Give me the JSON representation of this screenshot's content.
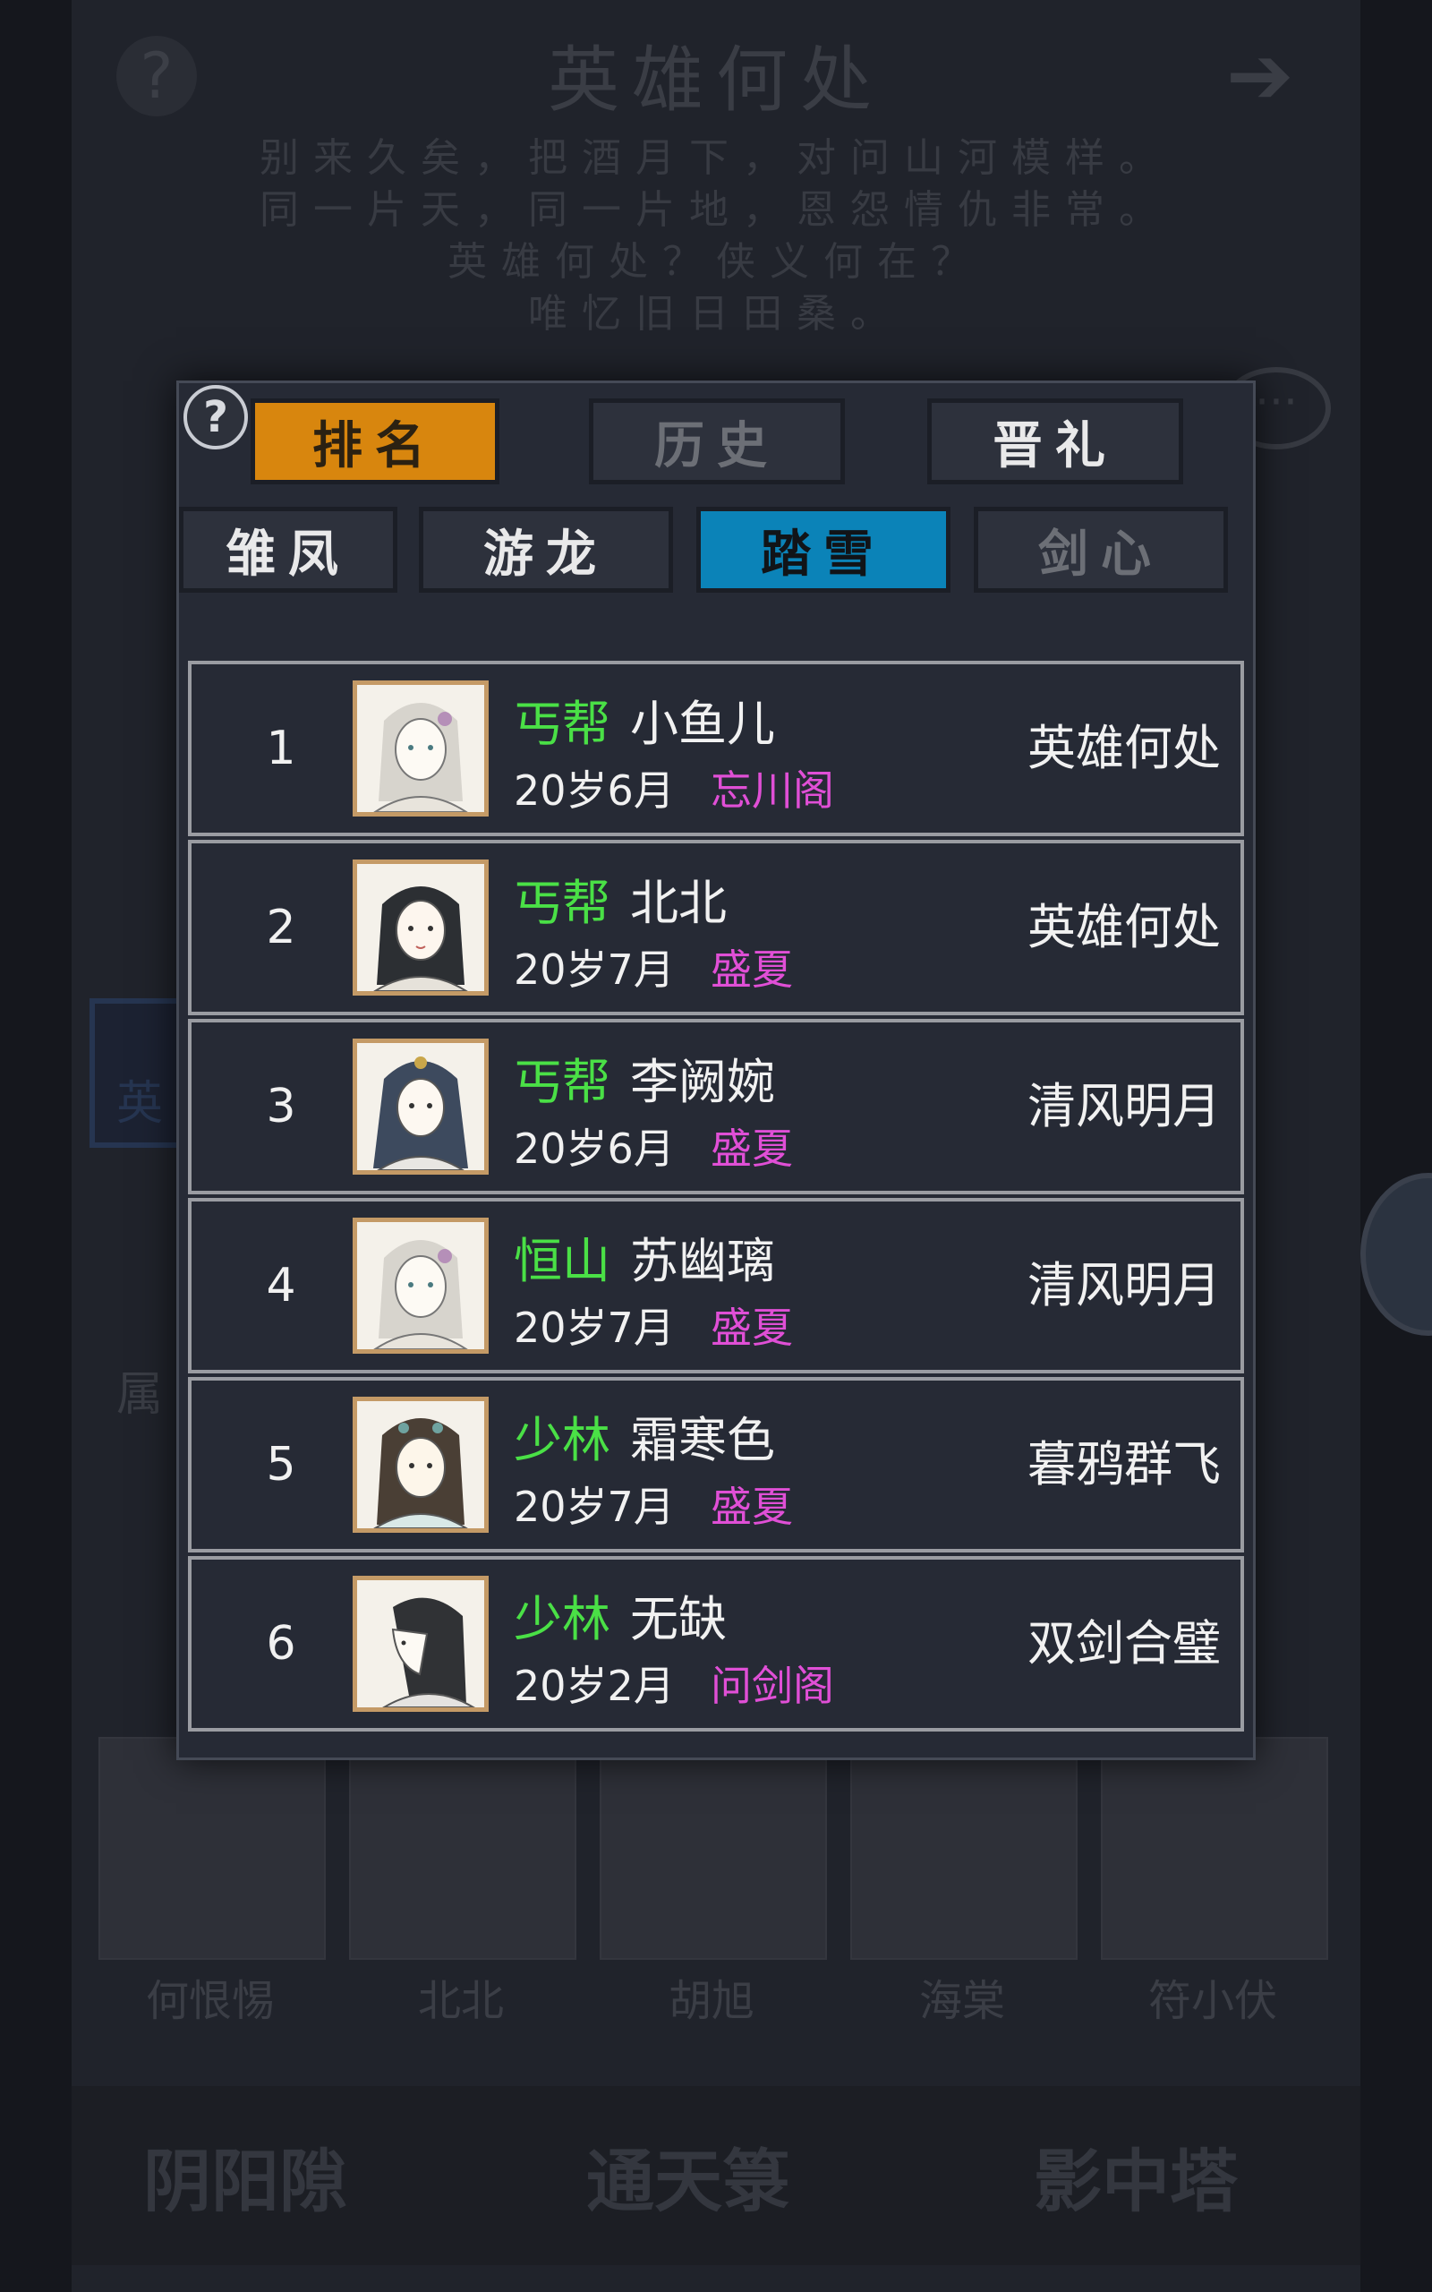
{
  "background": {
    "title": "英雄何处",
    "poem": [
      "别来久矣，把酒月下，对问山河模样。",
      "同一片天，同一片地，恩怨情仇非常。",
      "英雄何处？侠义何在？",
      "唯忆旧日田桑。"
    ],
    "side_label": "英",
    "attr_label": "属",
    "portraits": [
      "何恨惕",
      "北北",
      "胡旭",
      "海棠",
      "符小伏"
    ],
    "bottom_buttons": [
      "阴阳隙",
      "通天箓",
      "影中塔"
    ]
  },
  "modal": {
    "help_symbol": "?",
    "top_tabs": [
      {
        "label": "排名",
        "state": "active"
      },
      {
        "label": "历史",
        "state": "disabled"
      },
      {
        "label": "晋礼",
        "state": "normal"
      }
    ],
    "sub_tabs": [
      {
        "label": "雏凤",
        "state": "normal"
      },
      {
        "label": "游龙",
        "state": "normal"
      },
      {
        "label": "踏雪",
        "state": "active"
      },
      {
        "label": "剑心",
        "state": "disabled"
      }
    ],
    "rows": [
      {
        "rank": "1",
        "sect": "丐帮",
        "name": "小鱼儿",
        "age": "20岁6月",
        "guild": "忘川阁",
        "server": "英雄何处"
      },
      {
        "rank": "2",
        "sect": "丐帮",
        "name": "北北",
        "age": "20岁7月",
        "guild": "盛夏",
        "server": "英雄何处"
      },
      {
        "rank": "3",
        "sect": "丐帮",
        "name": "李阙婉",
        "age": "20岁6月",
        "guild": "盛夏",
        "server": "清风明月"
      },
      {
        "rank": "4",
        "sect": "恒山",
        "name": "苏幽璃",
        "age": "20岁7月",
        "guild": "盛夏",
        "server": "清风明月"
      },
      {
        "rank": "5",
        "sect": "少林",
        "name": "霜寒色",
        "age": "20岁7月",
        "guild": "盛夏",
        "server": "暮鸦群飞"
      },
      {
        "rank": "6",
        "sect": "少林",
        "name": "无缺",
        "age": "20岁2月",
        "guild": "问剑阁",
        "server": "双剑合璧"
      }
    ]
  },
  "colors": {
    "active_tab": "#d8860e",
    "active_subtab": "#0b83b8",
    "sect_text": "#4ae046",
    "guild_text": "#e04fd6"
  }
}
